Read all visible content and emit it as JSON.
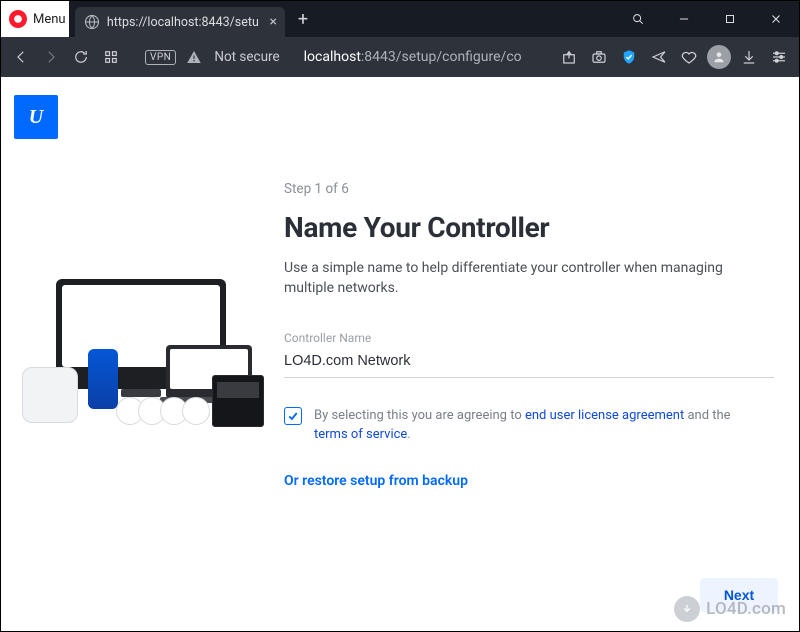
{
  "browser": {
    "menu_label": "Menu",
    "tab": {
      "title": "https://localhost:8443/setu"
    },
    "security_label": "Not secure",
    "vpn_label": "VPN",
    "url": {
      "host": "localhost",
      "port_path": ":8443/setup/configure/co"
    }
  },
  "brand": {
    "logo_letter": "U"
  },
  "setup": {
    "step_label": "Step 1 of 6",
    "heading": "Name Your Controller",
    "description": "Use a simple name to help differentiate your controller when managing multiple networks.",
    "field_label": "Controller Name",
    "field_value": "LO4D.com Network",
    "agree_prefix": "By selecting this you are agreeing to ",
    "eula_link": "end user license agreement",
    "agree_mid": " and the ",
    "tos_link": "terms of service",
    "agree_suffix": ".",
    "restore_link": "Or restore setup from backup",
    "next_label": "Next"
  },
  "watermark": {
    "text": "LO4D.com"
  }
}
